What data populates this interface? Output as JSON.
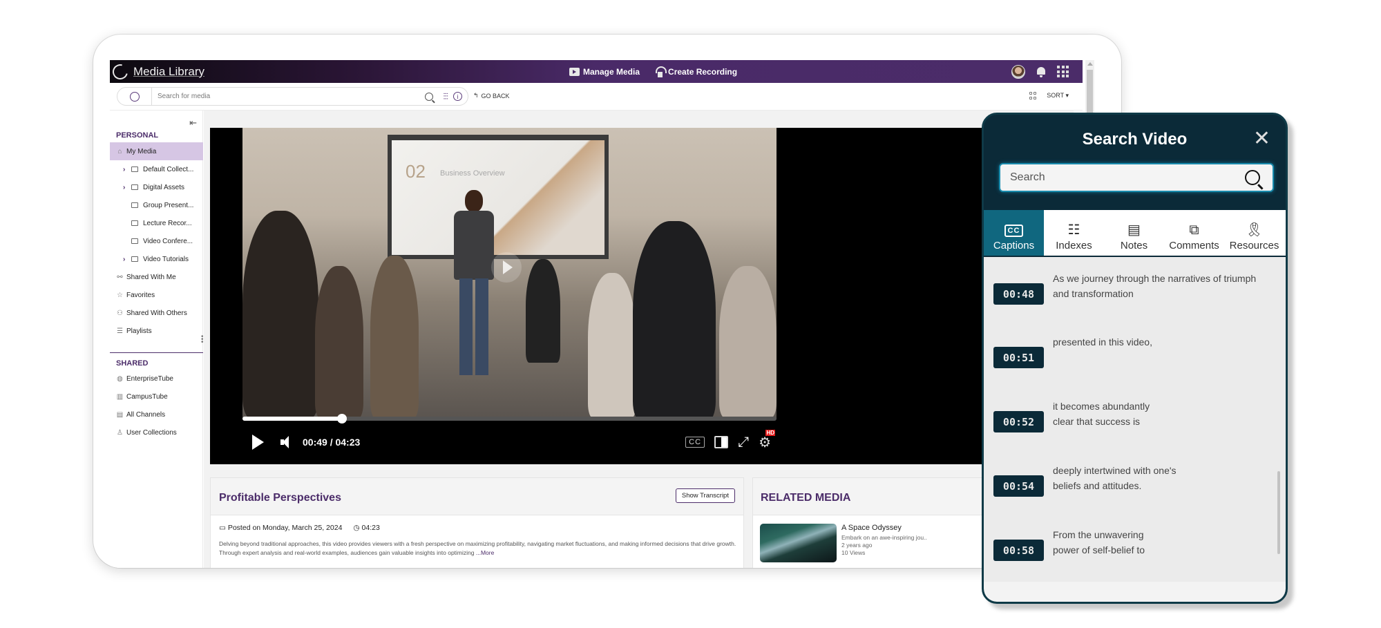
{
  "app": {
    "title": "Media Library",
    "header_links": [
      {
        "label": "Manage Media",
        "icon": "media-folder-icon"
      },
      {
        "label": "Create Recording",
        "icon": "recording-icon"
      }
    ]
  },
  "search": {
    "placeholder": "Search for media",
    "go_back_label": "GO BACK",
    "sort_label": "SORT"
  },
  "sidebar": {
    "personal_title": "PERSONAL",
    "shared_title": "SHARED",
    "personal_items": [
      {
        "label": "My Media",
        "icon": "home-icon",
        "active": true
      },
      {
        "label": "Default Collect...",
        "icon": "folder-icon",
        "expandable": true
      },
      {
        "label": "Digital Assets",
        "icon": "folder-icon",
        "expandable": true
      },
      {
        "label": "Group Present...",
        "icon": "folder-icon"
      },
      {
        "label": "Lecture Recor...",
        "icon": "folder-icon"
      },
      {
        "label": "Video Confere...",
        "icon": "folder-icon"
      },
      {
        "label": "Video Tutorials",
        "icon": "folder-icon",
        "expandable": true
      },
      {
        "label": "Shared With Me",
        "icon": "share-icon"
      },
      {
        "label": "Favorites",
        "icon": "star-icon"
      },
      {
        "label": "Shared With Others",
        "icon": "users-share-icon"
      },
      {
        "label": "Playlists",
        "icon": "playlist-icon"
      }
    ],
    "shared_items": [
      {
        "label": "EnterpriseTube",
        "icon": "globe-icon"
      },
      {
        "label": "CampusTube",
        "icon": "building-icon"
      },
      {
        "label": "All Channels",
        "icon": "library-icon"
      },
      {
        "label": "User Collections",
        "icon": "user-icon"
      }
    ]
  },
  "player": {
    "slide_number": "02",
    "slide_title": "Business Overview",
    "current_time": "00:49",
    "duration": "04:23",
    "time_display": "00:49 / 04:23",
    "progress_fraction": 0.186,
    "cc_label": "CC",
    "hd_badge": "HD"
  },
  "video_info": {
    "title": "Profitable Perspectives",
    "show_transcript_label": "Show Transcript",
    "posted": "Posted on Monday, March 25, 2024",
    "duration": "04:23",
    "description": "Delving beyond traditional approaches, this video provides viewers with a fresh perspective on maximizing profitability, navigating market fluctuations, and making informed decisions that drive growth. Through expert analysis and real-world examples, audiences gain valuable insights into optimizing ",
    "more_label": "...More"
  },
  "related": {
    "title": "RELATED MEDIA",
    "items": [
      {
        "name": "A Space Odyssey",
        "description": "Embark on an awe-inspiring jou..",
        "age": "2 years ago",
        "views": "10 Views"
      }
    ]
  },
  "search_panel": {
    "title": "Search Video",
    "search_placeholder": "Search",
    "tabs": [
      {
        "label": "Captions",
        "icon": "captions-icon",
        "active": true
      },
      {
        "label": "Indexes",
        "icon": "list-icon"
      },
      {
        "label": "Notes",
        "icon": "notepad-icon"
      },
      {
        "label": "Comments",
        "icon": "comments-icon"
      },
      {
        "label": "Resources",
        "icon": "award-icon"
      }
    ],
    "captions": [
      {
        "time": "00:48",
        "text": "As we journey through the narratives of triumph and transformation"
      },
      {
        "time": "00:51",
        "text": "presented in this video,"
      },
      {
        "time": "00:52",
        "text": "it becomes abundantly clear that success is"
      },
      {
        "time": "00:54",
        "text": "deeply intertwined with one's beliefs and attitudes."
      },
      {
        "time": "00:58",
        "text": "From the unwavering power of self-belief to"
      }
    ]
  },
  "colors": {
    "brand_purple": "#4b2c69",
    "panel_dark": "#0b2a38",
    "tab_active": "#10677f",
    "hd_red": "#e61c1c"
  }
}
